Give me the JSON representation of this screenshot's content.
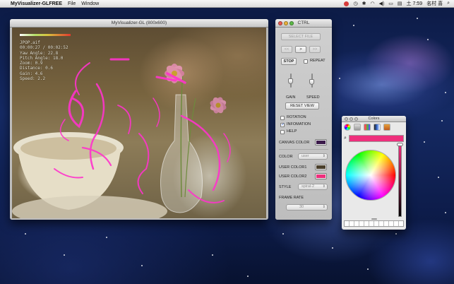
{
  "menubar": {
    "app_name": "MyVisualizer-GLFREE",
    "items": [
      "File",
      "Window"
    ],
    "clock": "土 7:59",
    "user": "名村 喜"
  },
  "viz_window": {
    "title": "MyVisualizer-GL (800x600)",
    "info_lines": [
      "JPOP.aif",
      "00:00:27 / 00:02:52",
      "Yaw Angle: 22.8",
      "Pitch Angle: 18.0",
      "Zoom: 0.9",
      "Distance: 0.6",
      "Gain: 4.6",
      "Speed: 2.2"
    ]
  },
  "ctrl": {
    "title": "CTRL",
    "select_file": "SELECT FILE",
    "prev": "<<",
    "play": ">",
    "next": ">>",
    "stop": "STOP",
    "repeat": "REPEAT",
    "gain": "GAIN",
    "speed": "SPEED",
    "reset_view": "RESET VIEW",
    "rotation": "ROTATION",
    "infomation": "INFOMATION",
    "help": "HELP",
    "canvas_color": "CANVAS COLOR",
    "color": "COLOR",
    "color_value": "user",
    "user_color1": "USER COLOR1",
    "user_color2": "USER COLOR2",
    "style": "STYLE",
    "style_value": "spiral-2",
    "frame_rate": "FRAME RATE",
    "frame_rate_value": "30",
    "checks": {
      "repeat": false,
      "rotation": false,
      "infomation": true,
      "help": false
    },
    "swatches": {
      "canvas_color": "#3b1a4a",
      "user_color1": "#4a3f2b",
      "user_color2": "#ee2f7c"
    }
  },
  "colors_panel": {
    "title": "Colors",
    "current_color": "#ee2f7c"
  }
}
